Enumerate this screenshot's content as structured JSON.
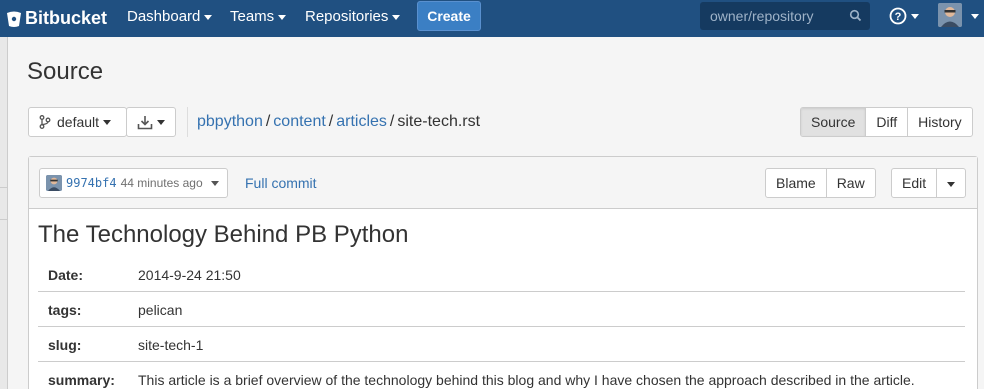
{
  "topnav": {
    "brand": "Bitbucket",
    "menu": [
      "Dashboard",
      "Teams",
      "Repositories"
    ],
    "create_label": "Create",
    "search_placeholder": "owner/repository",
    "help_icon": "question-circle-icon"
  },
  "page": {
    "title": "Source"
  },
  "toolbar": {
    "branch": "default",
    "download_icon": "download-icon",
    "breadcrumb": [
      "pbpython",
      "content",
      "articles",
      "site-tech.rst"
    ],
    "view_tabs": [
      "Source",
      "Diff",
      "History"
    ],
    "active_tab": "Source"
  },
  "file": {
    "commit_hash": "9974bf4",
    "commit_age": "44 minutes ago",
    "full_commit_label": "Full commit",
    "actions": [
      "Blame",
      "Raw"
    ],
    "edit_label": "Edit"
  },
  "document": {
    "title": "The Technology Behind PB Python",
    "fields": [
      {
        "key": "Date:",
        "value": "2014-9-24 21:50"
      },
      {
        "key": "tags:",
        "value": "pelican"
      },
      {
        "key": "slug:",
        "value": "site-tech-1"
      },
      {
        "key": "summary:",
        "value": "This article is a brief overview of the technology behind this blog and why I have chosen the approach described in the article."
      }
    ]
  },
  "colors": {
    "nav_bg": "#205081",
    "create_bg": "#3b7fc4",
    "link": "#3572b0"
  }
}
